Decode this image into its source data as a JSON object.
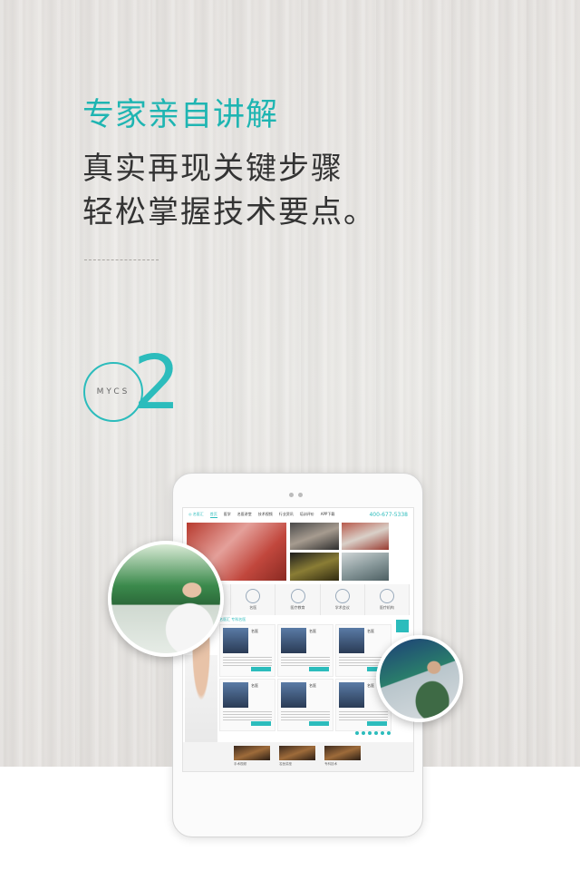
{
  "page": {
    "headline": "专家亲自讲解",
    "subline_1": "真实再现关键步骤",
    "subline_2": "轻松掌握技术要点。",
    "badge_text": "MYCS",
    "badge_number": "2"
  },
  "tablet": {
    "logo": "◎ 名医汇",
    "nav_items": [
      "首页",
      "医学",
      "名医讲堂",
      "技术视频",
      "行业资讯",
      "培训评价",
      "APP下载"
    ],
    "phone": "400-677-5338",
    "services": [
      "名医讲堂",
      "名医",
      "医疗教育",
      "学术会议",
      "医疗机构"
    ],
    "section_label": "名医汇 专科名医",
    "doctors": [
      "名医",
      "名医",
      "名医",
      "名医",
      "名医",
      "名医"
    ],
    "videos": [
      "手术视频",
      "名医讲座",
      "专科技术"
    ]
  },
  "colors": {
    "accent": "#2cbcbc",
    "headline": "#1fb5b2",
    "text": "#333333"
  }
}
